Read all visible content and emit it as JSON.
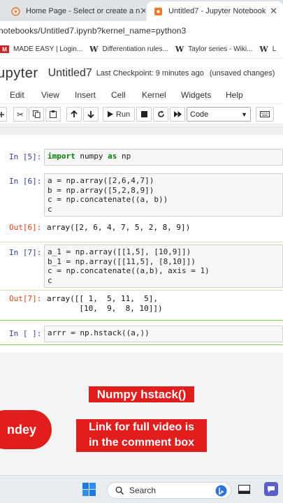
{
  "browser": {
    "tabs": [
      {
        "label": "Home Page - Select or create a n",
        "active": false
      },
      {
        "label": "Untitled7 - Jupyter Notebook",
        "active": true
      }
    ],
    "url": "notebooks/Untitled7.ipynb?kernel_name=python3",
    "bookmarks": [
      {
        "label": "MADE EASY | Login...",
        "icon": "made-easy-logo"
      },
      {
        "label": "Differentiation rules...",
        "icon": "wikipedia-w"
      },
      {
        "label": "Taylor series - Wiki...",
        "icon": "wikipedia-w"
      },
      {
        "label": "L",
        "icon": "wikipedia-w"
      }
    ]
  },
  "jupyter": {
    "logo": "upyter",
    "notebook_name": "Untitled7",
    "checkpoint": "Last Checkpoint: 9 minutes ago",
    "status": "(unsaved changes)",
    "menu": [
      "Edit",
      "View",
      "Insert",
      "Cell",
      "Kernel",
      "Widgets",
      "Help"
    ],
    "toolbar": {
      "run_label": "Run",
      "cell_type": "Code"
    }
  },
  "cells": [
    {
      "in_prompt": "In [5]:",
      "code": [
        "import numpy as np"
      ]
    },
    {
      "in_prompt": "In [6]:",
      "code": [
        "a = np.array([2,6,4,7])",
        "b = np.array([5,2,8,9])",
        "c = np.concatenate((a, b))",
        "c"
      ],
      "out_prompt": "Out[6]:",
      "output": [
        "array([2, 6, 4, 7, 5, 2, 8, 9])"
      ]
    },
    {
      "in_prompt": "In [7]:",
      "code": [
        "a_1 = np.array([[1,5], [10,9]])",
        "b_1 = np.array([[11,5], [8,10]])",
        "c = np.concatenate((a,b), axis = 1)",
        "c"
      ],
      "out_prompt": "Out[7]:",
      "output": [
        "array([[ 1,  5, 11,  5],",
        "       [10,  9,  8, 10]])"
      ]
    },
    {
      "in_prompt": "In [ ]:",
      "code": [
        "arrr = np.hstack((a,))"
      ]
    }
  ],
  "overlay": {
    "title": "Numpy hstack()",
    "name_fragment": "ndey",
    "link_line1": "Link for full video is",
    "link_line2": "in the comment box"
  },
  "taskbar": {
    "search_placeholder": "Search"
  },
  "colors": {
    "caption_red": "#e11d1d",
    "prompt_in": "#303f9f",
    "prompt_out": "#d84315",
    "keyword": "#008000"
  }
}
